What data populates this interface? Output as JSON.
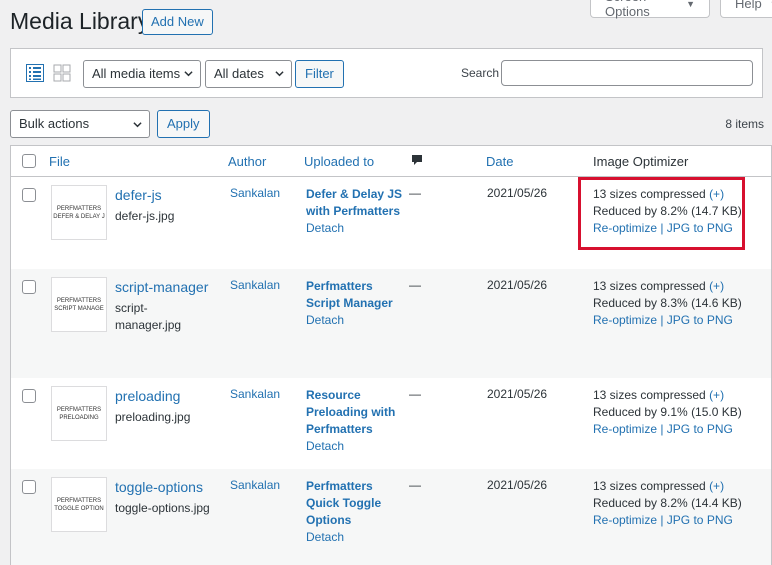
{
  "header": {
    "title": "Media Library",
    "add_new": "Add New",
    "screen_options": "Screen Options",
    "help": "Help"
  },
  "toolbar": {
    "media_type": "All media items",
    "dates": "All dates",
    "filter": "Filter",
    "search_label": "Search",
    "search_value": ""
  },
  "bulk": {
    "action": "Bulk actions",
    "apply": "Apply",
    "count": "8 items"
  },
  "table": {
    "headers": {
      "file": "File",
      "author": "Author",
      "uploaded_to": "Uploaded to",
      "date": "Date",
      "optimizer": "Image Optimizer"
    },
    "rows": [
      {
        "title": "defer-js",
        "filename_lines": [
          "defer-js.jpg"
        ],
        "thumb_lines": [
          "PERFMATTERS",
          "DEFER & DELAY J"
        ],
        "author": "Sankalan",
        "post_lines": [
          "Defer & Delay JS",
          "with Perfmatters"
        ],
        "detach": "Detach",
        "comments": "—",
        "date": "2021/05/26",
        "sizes": "13 sizes compressed",
        "plus": "(+)",
        "reduced": "Reduced by 8.2% (14.7 KB)",
        "actions": "Re-optimize | JPG to PNG"
      },
      {
        "title": "script-manager",
        "filename_lines": [
          "script-",
          "manager.jpg"
        ],
        "thumb_lines": [
          "PERFMATTERS",
          "SCRIPT MANAGE"
        ],
        "author": "Sankalan",
        "post_lines": [
          "Perfmatters",
          "Script Manager"
        ],
        "detach": "Detach",
        "comments": "—",
        "date": "2021/05/26",
        "sizes": "13 sizes compressed",
        "plus": "(+)",
        "reduced": "Reduced by 8.3% (14.6 KB)",
        "actions": "Re-optimize | JPG to PNG"
      },
      {
        "title": "preloading",
        "filename_lines": [
          "preloading.jpg"
        ],
        "thumb_lines": [
          "PERFMATTERS",
          "PRELOADING"
        ],
        "author": "Sankalan",
        "post_lines": [
          "Resource",
          "Preloading with",
          "Perfmatters"
        ],
        "detach": "Detach",
        "comments": "—",
        "date": "2021/05/26",
        "sizes": "13 sizes compressed",
        "plus": "(+)",
        "reduced": "Reduced by 9.1% (15.0 KB)",
        "actions": "Re-optimize | JPG to PNG"
      },
      {
        "title": "toggle-options",
        "filename_lines": [
          "toggle-options.jpg"
        ],
        "thumb_lines": [
          "PERFMATTERS",
          "TOGGLE OPTION"
        ],
        "author": "Sankalan",
        "post_lines": [
          "Perfmatters",
          "Quick Toggle",
          "Options"
        ],
        "detach": "Detach",
        "comments": "—",
        "date": "2021/05/26",
        "sizes": "13 sizes compressed",
        "plus": "(+)",
        "reduced": "Reduced by 8.2% (14.4 KB)",
        "actions": "Re-optimize | JPG to PNG"
      }
    ]
  }
}
